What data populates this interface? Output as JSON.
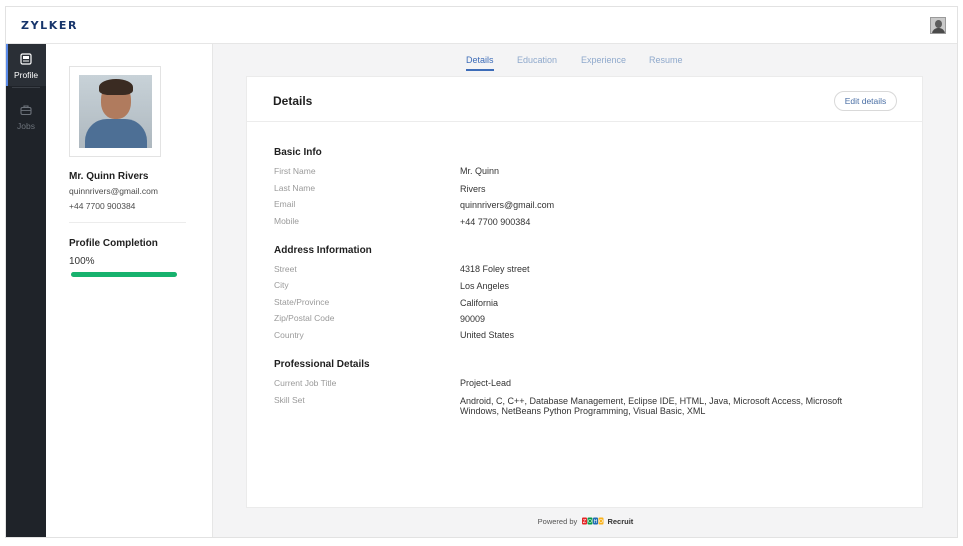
{
  "header": {
    "logo": "ZYLKER"
  },
  "sidenav": {
    "items": [
      {
        "label": "Profile"
      },
      {
        "label": "Jobs"
      }
    ]
  },
  "profile": {
    "name": "Mr. Quinn Rivers",
    "email": "quinnrivers@gmail.com",
    "phone": "+44 7700 900384",
    "completion_title": "Profile Completion",
    "completion_value": "100%",
    "completion_fraction": 1.0
  },
  "tabs": [
    {
      "label": "Details"
    },
    {
      "label": "Education"
    },
    {
      "label": "Experience"
    },
    {
      "label": "Resume"
    }
  ],
  "details": {
    "title": "Details",
    "edit_label": "Edit details",
    "basic": {
      "title": "Basic Info",
      "first_name_label": "First Name",
      "first_name": "Mr.  Quinn",
      "last_name_label": "Last Name",
      "last_name": "Rivers",
      "email_label": "Email",
      "email": "quinnrivers@gmail.com",
      "mobile_label": "Mobile",
      "mobile": "+44 7700 900384"
    },
    "address": {
      "title": "Address Information",
      "street_label": "Street",
      "street": "4318 Foley street",
      "city_label": "City",
      "city": "Los Angeles",
      "state_label": "State/Province",
      "state": "California",
      "zip_label": "Zip/Postal Code",
      "zip": "90009",
      "country_label": "Country",
      "country": "United States"
    },
    "professional": {
      "title": "Professional Details",
      "job_title_label": "Current Job Title",
      "job_title": "Project-Lead",
      "skill_set_label": "Skill Set",
      "skill_set": "Android, C, C++, Database Management, Eclipse IDE, HTML, Java, Microsoft Access, Microsoft Windows, NetBeans Python Programming, Visual Basic, XML"
    }
  },
  "footer": {
    "powered_by": "Powered by",
    "product": "Recruit",
    "brand_letters": [
      "Z",
      "O",
      "H",
      "O"
    ]
  },
  "colors": {
    "accent": "#3d6cb8",
    "progress": "#17b26e",
    "sidebar": "#1f2329",
    "brand": "#17356b"
  }
}
